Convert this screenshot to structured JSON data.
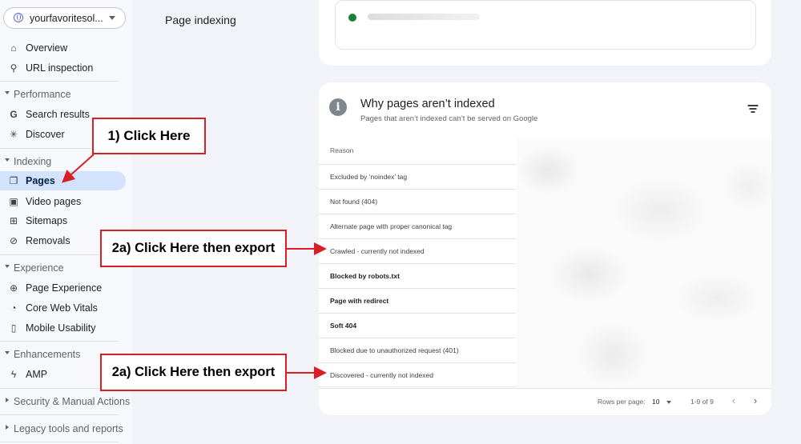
{
  "property": {
    "name": "yourfavoritesol..."
  },
  "header": {
    "title": "Page indexing"
  },
  "sidebar": {
    "top_items": [
      {
        "label": "Overview",
        "icon": "home-icon"
      },
      {
        "label": "URL inspection",
        "icon": "search-icon"
      }
    ],
    "sections": [
      {
        "label": "Performance",
        "items": [
          {
            "label": "Search results",
            "icon": "google-g-icon"
          },
          {
            "label": "Discover",
            "icon": "asterisk-icon"
          }
        ]
      },
      {
        "label": "Indexing",
        "items": [
          {
            "label": "Pages",
            "icon": "pages-icon",
            "active": true
          },
          {
            "label": "Video pages",
            "icon": "video-icon"
          },
          {
            "label": "Sitemaps",
            "icon": "sitemap-icon"
          },
          {
            "label": "Removals",
            "icon": "eye-off-icon"
          }
        ]
      },
      {
        "label": "Experience",
        "items": [
          {
            "label": "Page Experience",
            "icon": "plus-circle-icon"
          },
          {
            "label": "Core Web Vitals",
            "icon": "gauge-icon"
          },
          {
            "label": "Mobile Usability",
            "icon": "phone-icon"
          }
        ]
      },
      {
        "label": "Enhancements",
        "items": [
          {
            "label": "AMP",
            "icon": "bolt-icon"
          }
        ]
      },
      {
        "label": "Security & Manual Actions",
        "items": []
      },
      {
        "label": "Legacy tools and reports",
        "items": []
      }
    ]
  },
  "card": {
    "title": "Why pages aren’t indexed",
    "subtitle": "Pages that aren’t indexed can’t be served on Google",
    "column_header": "Reason",
    "rows": [
      {
        "reason": "Excluded by ‘noindex’ tag",
        "bold": false
      },
      {
        "reason": "Not found (404)",
        "bold": false
      },
      {
        "reason": "Alternate page with proper canonical tag",
        "bold": false
      },
      {
        "reason": "Crawled - currently not indexed",
        "bold": false
      },
      {
        "reason": "Blocked by robots.txt",
        "bold": true
      },
      {
        "reason": "Page with redirect",
        "bold": true
      },
      {
        "reason": "Soft 404",
        "bold": true
      },
      {
        "reason": "Blocked due to unauthorized request (401)",
        "bold": false
      },
      {
        "reason": "Discovered - currently not indexed",
        "bold": false
      }
    ],
    "footer": {
      "rows_per_page_label": "Rows per page:",
      "rows_per_page_value": "10",
      "range": "1-9 of 9"
    }
  },
  "annotations": {
    "step1": "1) Click Here",
    "step2a_first": "2a) Click Here then export",
    "step2a_second": "2a) Click Here then export",
    "color": "#d91f26"
  }
}
